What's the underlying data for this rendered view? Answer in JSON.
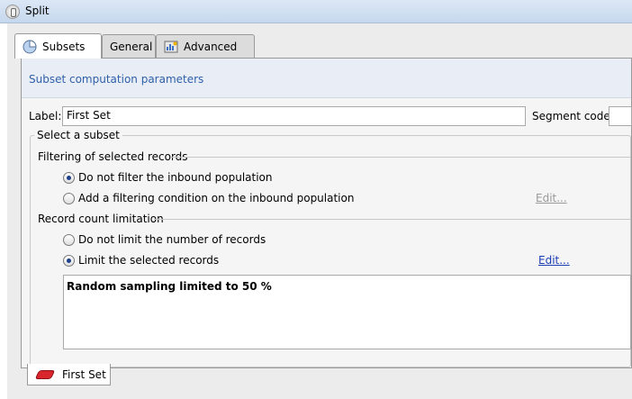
{
  "window": {
    "title": "Split"
  },
  "tabs": [
    {
      "label": "Subsets",
      "icon": "pie-chart-icon",
      "active": true
    },
    {
      "label": "General",
      "active": false
    },
    {
      "label": "Advanced",
      "icon": "settings-chart-icon",
      "active": false
    }
  ],
  "section_header": "Subset computation parameters",
  "form": {
    "label_label": "Label:",
    "label_value": "First Set",
    "segment_code_label": "Segment code:",
    "segment_code_value": "",
    "select_subset_legend": "Select a subset",
    "filtering": {
      "title": "Filtering of selected records",
      "options": [
        {
          "label": "Do not filter the inbound population",
          "checked": true
        },
        {
          "label": "Add a filtering condition on the inbound population",
          "checked": false
        }
      ],
      "edit_label": "Edit...",
      "edit_enabled": false
    },
    "limitation": {
      "title": "Record count limitation",
      "options": [
        {
          "label": "Do not limit the number of records",
          "checked": false
        },
        {
          "label": "Limit the selected records",
          "checked": true
        }
      ],
      "edit_label": "Edit...",
      "edit_enabled": true
    },
    "summary_text": "Random sampling limited to 50 %"
  },
  "bottom_tabs": [
    {
      "label": "First Set",
      "icon": "eraser-icon"
    }
  ],
  "colors": {
    "header_text": "#2f5fa8",
    "link": "#1a3fb5",
    "radio_dot": "#1f3f8a",
    "subset_icon": "#d9252c"
  }
}
